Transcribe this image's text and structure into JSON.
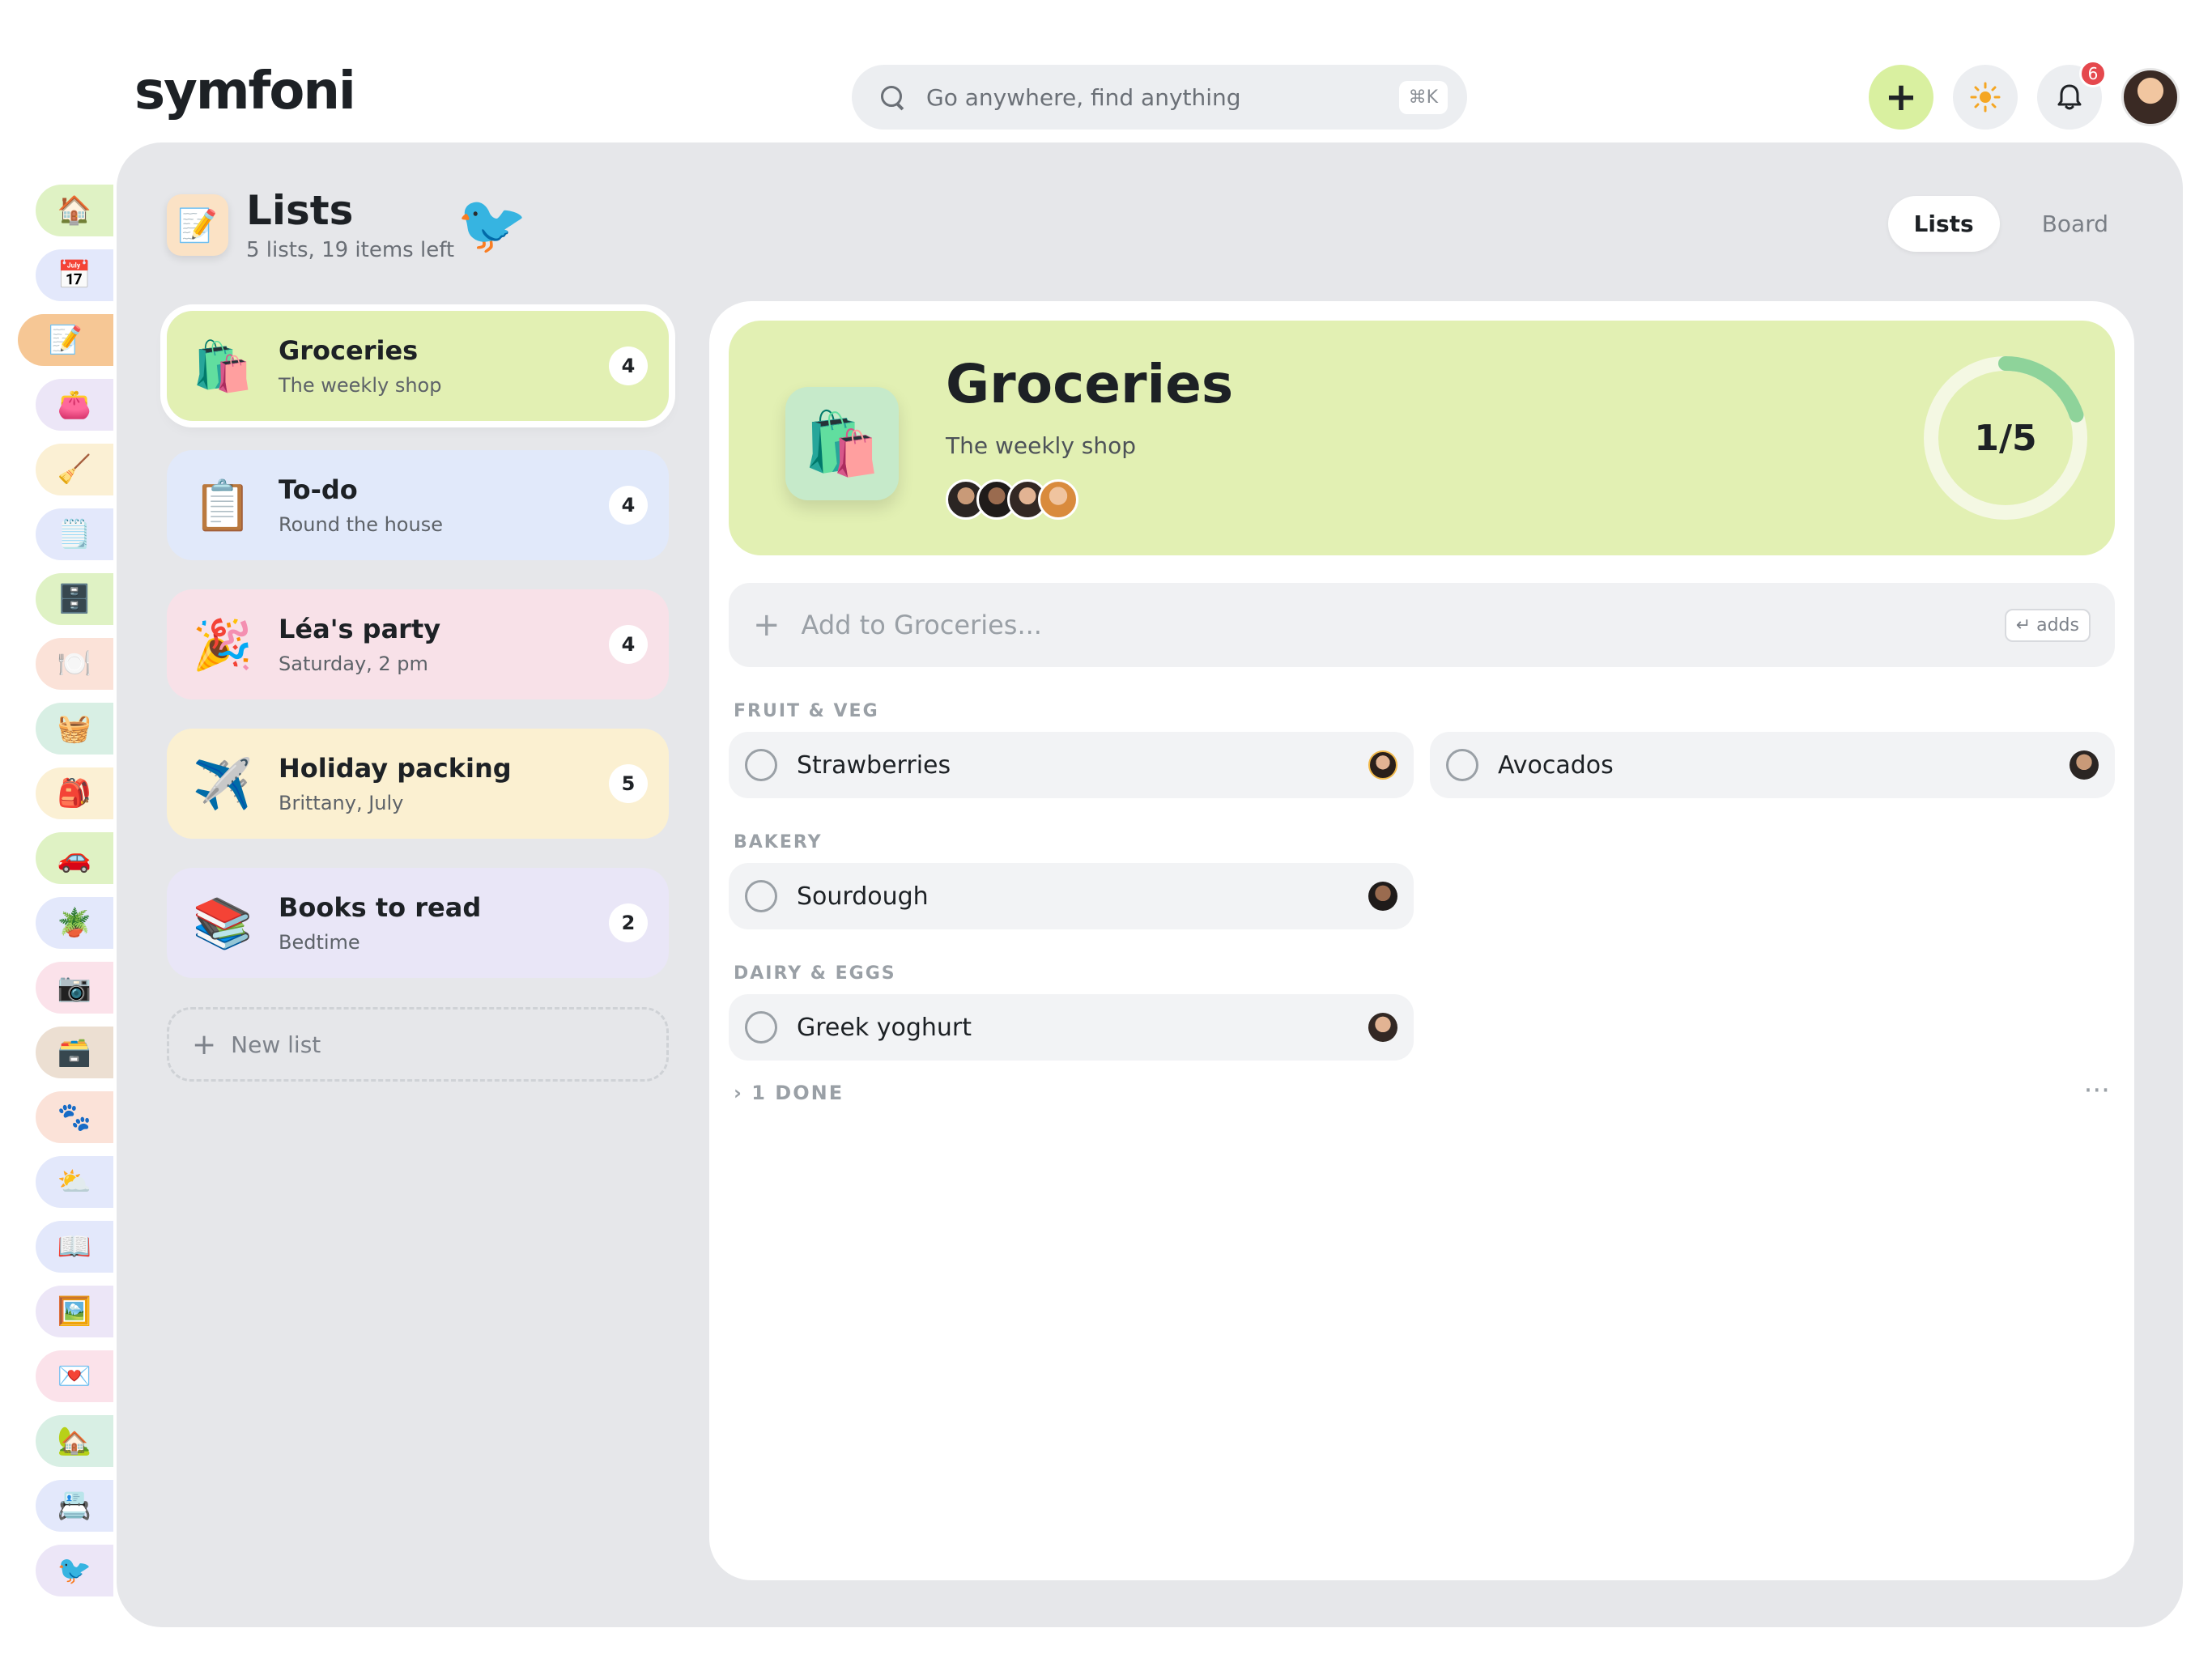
{
  "app": {
    "logo": "symfoni"
  },
  "search": {
    "placeholder": "Go anywhere, find anything",
    "shortcut": "⌘K"
  },
  "header_actions": {
    "add": "+",
    "notifications_count": "6"
  },
  "rail": {
    "items": [
      {
        "name": "rail-home",
        "icon": "🏠",
        "bg": "#dff2c4"
      },
      {
        "name": "rail-calendar",
        "icon": "📅",
        "bg": "#e3e8fb"
      },
      {
        "name": "rail-lists",
        "icon": "📝",
        "bg": "#f6c795",
        "active": true
      },
      {
        "name": "rail-wallet",
        "icon": "👛",
        "bg": "#ece6f7"
      },
      {
        "name": "rail-chores",
        "icon": "🧹",
        "bg": "#fbf0d4"
      },
      {
        "name": "rail-notes",
        "icon": "🗒️",
        "bg": "#e3e8fb"
      },
      {
        "name": "rail-fridge",
        "icon": "🗄️",
        "bg": "#dff2c4"
      },
      {
        "name": "rail-meals",
        "icon": "🍽️",
        "bg": "#fbe2d8"
      },
      {
        "name": "rail-appliance",
        "icon": "🧺",
        "bg": "#d8efe4"
      },
      {
        "name": "rail-school",
        "icon": "🎒",
        "bg": "#fbf0d4"
      },
      {
        "name": "rail-car",
        "icon": "🚗",
        "bg": "#dff2c4"
      },
      {
        "name": "rail-garden",
        "icon": "🪴",
        "bg": "#e3e8fb"
      },
      {
        "name": "rail-camera",
        "icon": "📷",
        "bg": "#fbe2ea"
      },
      {
        "name": "rail-documents",
        "icon": "🗃️",
        "bg": "#ecdfd2"
      },
      {
        "name": "rail-pets",
        "icon": "🐾",
        "bg": "#fbe2d8"
      },
      {
        "name": "rail-weather",
        "icon": "⛅",
        "bg": "#e3e8fb"
      },
      {
        "name": "rail-books",
        "icon": "📖",
        "bg": "#e3e8fb"
      },
      {
        "name": "rail-photos",
        "icon": "🖼️",
        "bg": "#ece6f7"
      },
      {
        "name": "rail-mail",
        "icon": "💌",
        "bg": "#fbe2ea"
      },
      {
        "name": "rail-family",
        "icon": "🏡",
        "bg": "#d8efe4"
      },
      {
        "name": "rail-contacts",
        "icon": "📇",
        "bg": "#e3e8fb"
      },
      {
        "name": "rail-bird",
        "icon": "🐦",
        "bg": "#ece6f7"
      }
    ]
  },
  "page": {
    "title": "Lists",
    "subtitle": "5 lists, 19 items left"
  },
  "view_toggle": {
    "lists": "Lists",
    "board": "Board"
  },
  "lists": [
    {
      "name": "Groceries",
      "sub": "The weekly shop",
      "count": "4",
      "icon": "🛍️",
      "bg": "#e2f0b3",
      "selected": true
    },
    {
      "name": "To-do",
      "sub": "Round the house",
      "count": "4",
      "icon": "📋",
      "bg": "#e1e9fa"
    },
    {
      "name": "Léa's party",
      "sub": "Saturday, 2 pm",
      "count": "4",
      "icon": "🎉",
      "bg": "#f8e1e8"
    },
    {
      "name": "Holiday packing",
      "sub": "Brittany, July",
      "count": "5",
      "icon": "✈️",
      "bg": "#fbf0d1"
    },
    {
      "name": "Books to read",
      "sub": "Bedtime",
      "count": "2",
      "icon": "📚",
      "bg": "#e9e6f7"
    }
  ],
  "new_list": "New list",
  "detail": {
    "title": "Groceries",
    "subtitle": "The weekly shop",
    "progress_text": "1/5",
    "progress_fraction": 0.2,
    "add_placeholder": "Add to Groceries...",
    "add_hint": "↵ adds",
    "sections": [
      {
        "label": "FRUIT & VEG",
        "items": [
          "Strawberries",
          "Avocados"
        ]
      },
      {
        "label": "BAKERY",
        "items": [
          "Sourdough"
        ]
      },
      {
        "label": "DAIRY & EGGS",
        "items": [
          "Greek yoghurt"
        ]
      }
    ],
    "done_label": "1 DONE",
    "more": "···"
  }
}
